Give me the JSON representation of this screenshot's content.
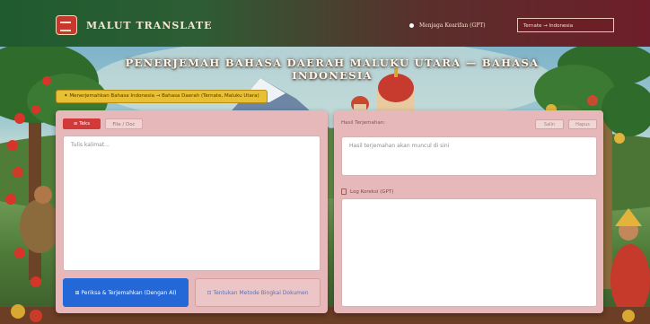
{
  "header": {
    "brand": "MALUT TRANSLATE",
    "status": "Menjaga Kearifan (GPT)",
    "language_select": "Ternate → Indonesia"
  },
  "main": {
    "title": "PENERJEMAH BAHASA DAERAH MALUKU UTARA — BAHASA INDONESIA",
    "language_pill": "✦ Menerjemahkan Bahasa Indonesia → Bahasa Daerah (Ternate, Maluku Utara)"
  },
  "left_panel": {
    "tab_text": "≡ Teks",
    "tab_file": "File / Doc",
    "input_placeholder": "Tulis kalimat...",
    "translate_button": "⊞ Periksa & Terjemahkan (Dengan AI)",
    "document_button": "⊡ Tentukan Metode Bingkai Dokumen"
  },
  "right_panel": {
    "result_label": "Hasil Terjemahan:",
    "copy_button": "Salin",
    "clear_button": "Hapus",
    "result_placeholder": "Hasil terjemahan akan muncul di sini",
    "log_label": "Log Koreksi (GPT)"
  },
  "colors": {
    "header_start": "#1f5b2e",
    "header_end": "#6e1e2a",
    "primary_button": "#2467d6",
    "panel": "#e7b8ba",
    "pill": "#e8c033"
  }
}
